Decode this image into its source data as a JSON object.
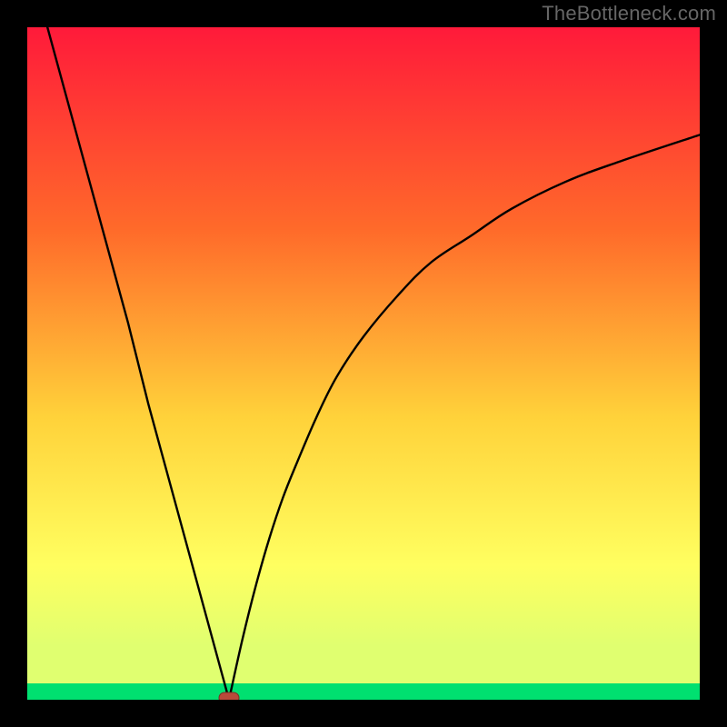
{
  "watermark": "TheBottleneck.com",
  "colors": {
    "frame": "#000000",
    "gradient_top": "#ff1a3a",
    "gradient_mid1": "#ff6a2a",
    "gradient_mid2": "#ffd23a",
    "gradient_mid3": "#ffff60",
    "gradient_mid4": "#e0ff70",
    "gradient_bottom_strip": "#00e070",
    "curve": "#000000",
    "marker_fill": "#b94a3a",
    "marker_stroke": "#7a2f25"
  },
  "chart_data": {
    "type": "line",
    "title": "",
    "xlabel": "",
    "ylabel": "",
    "xlim": [
      0,
      100
    ],
    "ylim": [
      0,
      100
    ],
    "notes": "V-shaped bottleneck curve: left branch nearly straight from ~(3,100) to minimum; right branch concave rising toward ~(100,84). Minimum at x≈30, y≈0. Background is a vertical red→orange→yellow→green gradient. A small rounded marker sits at the minimum.",
    "series": [
      {
        "name": "left-branch",
        "x": [
          3,
          6,
          9,
          12,
          15,
          18,
          21,
          24,
          27,
          30
        ],
        "y": [
          100,
          89,
          78,
          67,
          56,
          44,
          33,
          22,
          11,
          0
        ]
      },
      {
        "name": "right-branch",
        "x": [
          30,
          32,
          34,
          36,
          38,
          40,
          43,
          46,
          50,
          55,
          60,
          66,
          72,
          80,
          88,
          100
        ],
        "y": [
          0,
          9,
          17,
          24,
          30,
          35,
          42,
          48,
          54,
          60,
          65,
          69,
          73,
          77,
          80,
          84
        ]
      }
    ],
    "marker": {
      "x": 30,
      "y": 0
    }
  }
}
